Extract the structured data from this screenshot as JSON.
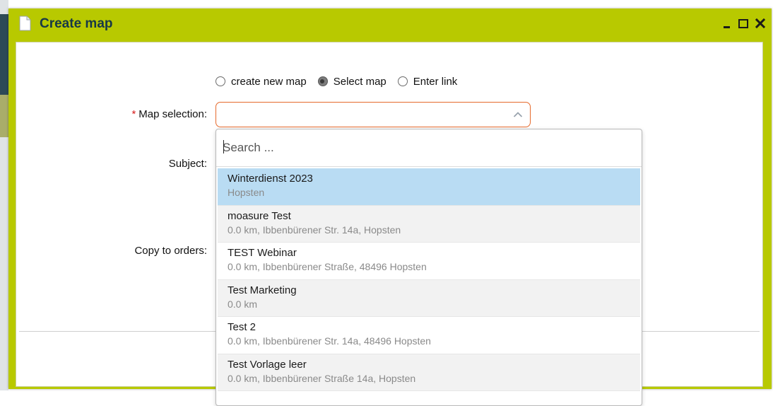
{
  "dialog": {
    "title": "Create map",
    "icon": "document-icon",
    "controls": [
      "minimize-icon",
      "maximize-icon",
      "close-icon"
    ]
  },
  "form": {
    "map_type": {
      "options": [
        {
          "label": "create new map",
          "checked": false
        },
        {
          "label": "Select map",
          "checked": true
        },
        {
          "label": "Enter link",
          "checked": false
        }
      ]
    },
    "map_selection": {
      "required_mark": "*",
      "label": "Map selection:",
      "value": ""
    },
    "subject_label": "Subject:",
    "copy_to_orders_label": "Copy to orders:"
  },
  "dropdown": {
    "search_placeholder": "Search ...",
    "items": [
      {
        "name": "Winterdienst 2023",
        "detail": "Hopsten",
        "highlighted": true
      },
      {
        "name": "moasure Test",
        "detail": "0.0 km, Ibbenbürener Str. 14a, Hopsten"
      },
      {
        "name": "TEST Webinar",
        "detail": "0.0 km, Ibbenbürener Straße, 48496 Hopsten"
      },
      {
        "name": "Test Marketing",
        "detail": "0.0 km"
      },
      {
        "name": "Test 2",
        "detail": "0.0 km, Ibbenbürener Str. 14a, 48496 Hopsten"
      },
      {
        "name": "Test Vorlage leer",
        "detail": "0.0 km, Ibbenbürener Straße 14a, Hopsten"
      }
    ]
  },
  "colors": {
    "titlebar": "#b8c900",
    "title_text": "#173847",
    "select_border_focus": "#e66a2c",
    "highlight": "#b9dcf3",
    "required": "#d61c1c"
  }
}
